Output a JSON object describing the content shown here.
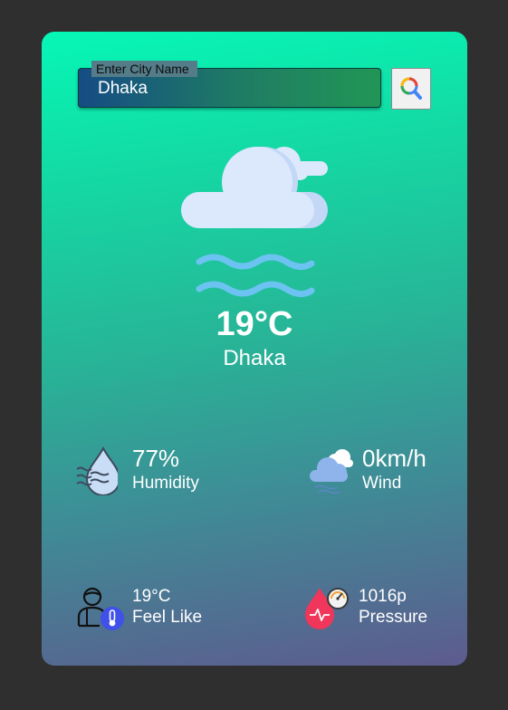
{
  "search": {
    "label": "Enter City Name",
    "value": "Dhaka"
  },
  "current": {
    "icon": "cloud-fog-icon",
    "temperature": "19°C",
    "city": "Dhaka"
  },
  "stats": {
    "humidity": {
      "value": "77%",
      "label": "Humidity",
      "icon": "humidity-drop-icon"
    },
    "wind": {
      "value": "0km/h",
      "label": "Wind",
      "icon": "windy-cloud-icon"
    },
    "feels_like": {
      "value": "19°C",
      "label": "Feel Like",
      "icon": "person-thermometer-icon"
    },
    "pressure": {
      "value": "1016p",
      "label": "Pressure",
      "icon": "blood-pressure-gauge-icon"
    }
  },
  "colors": {
    "page_bg": "#2f2f2f",
    "card_top": "#06f7b6",
    "card_bottom": "#5d5b8e",
    "text": "#ffffff"
  }
}
